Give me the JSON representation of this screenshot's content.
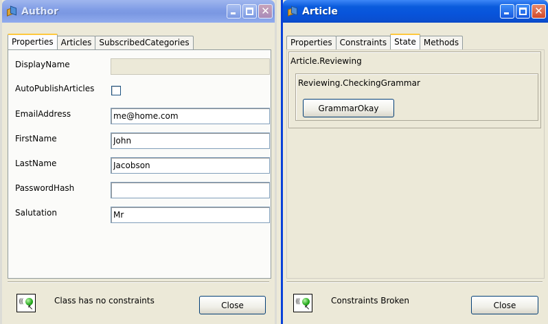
{
  "author_window": {
    "title": "Author",
    "tabs": [
      "Properties",
      "Articles",
      "SubscribedCategories"
    ],
    "selected_tab": "Properties",
    "fields": {
      "display_name": {
        "label": "DisplayName",
        "value": ""
      },
      "auto_publish_articles": {
        "label": "AutoPublishArticles",
        "checked": false
      },
      "email_address": {
        "label": "EmailAddress",
        "value": "me@home.com"
      },
      "first_name": {
        "label": "FirstName",
        "value": "John"
      },
      "last_name": {
        "label": "LastName",
        "value": "Jacobson"
      },
      "password_hash": {
        "label": "PasswordHash",
        "value": ""
      },
      "salutation": {
        "label": "Salutation",
        "value": "Mr"
      }
    },
    "status_text": "Class has no constraints",
    "close_label": "Close"
  },
  "article_window": {
    "title": "Article",
    "tabs": [
      "Properties",
      "Constraints",
      "State",
      "Methods"
    ],
    "selected_tab": "State",
    "state": {
      "outer_state": "Article.Reviewing",
      "inner_state": "Reviewing.CheckingGrammar",
      "transition_button": "GrammarOkay"
    },
    "status_text": "Constraints Broken",
    "close_label": "Close"
  },
  "icons": {
    "window_icon": "cube-app-icon",
    "status_icon": "constraint-status-icon"
  },
  "colors": {
    "active_titlebar": "#0a5bdc",
    "inactive_titlebar": "#7e9be5",
    "window_bg": "#ece9d8"
  }
}
